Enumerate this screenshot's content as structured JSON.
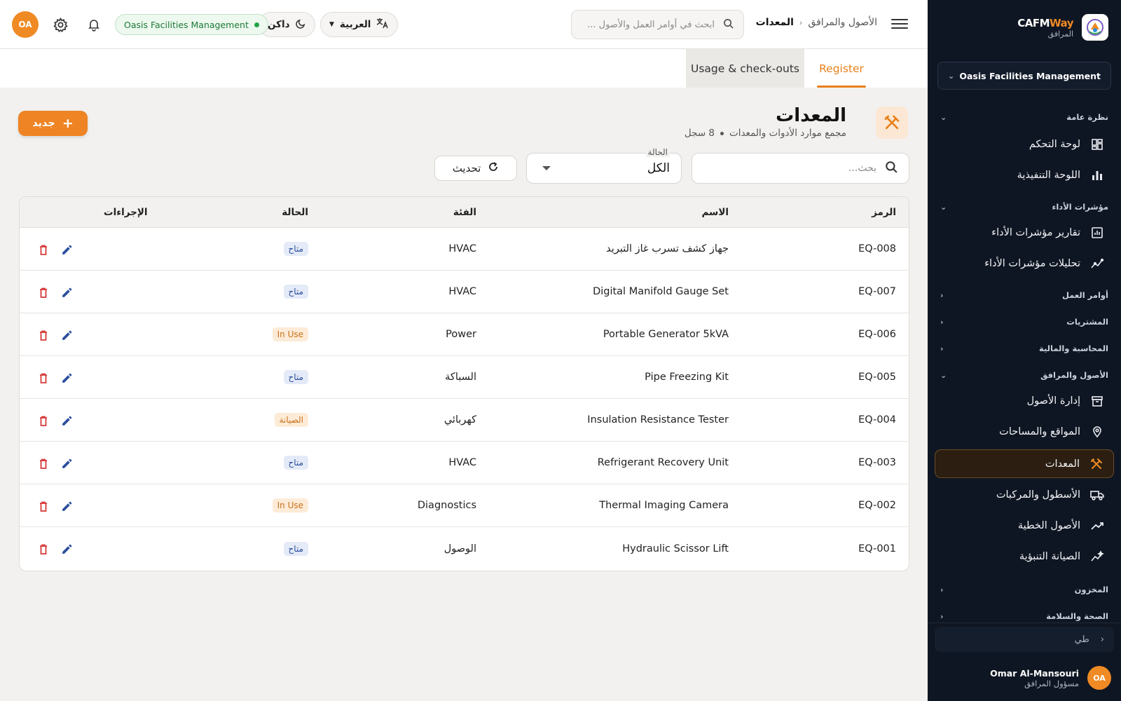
{
  "sidebar": {
    "brand": {
      "name_a": "CAFM",
      "name_b": "Way",
      "subtitle": "المرافق"
    },
    "org": "Oasis Facilities Management",
    "sections": [
      {
        "label": "نظرة عامة"
      },
      {
        "label": "مؤشرات الأداء"
      },
      {
        "label": "أوامر العمل"
      },
      {
        "label": "المشتريات"
      },
      {
        "label": "المحاسبة والمالية"
      },
      {
        "label": "الأصول والمرافق"
      },
      {
        "label": "المخزون"
      },
      {
        "label": "الصحة والسلامة"
      }
    ],
    "items": [
      {
        "label": "لوحة التحكم",
        "icon": "dashboard-icon"
      },
      {
        "label": "اللوحة التنفيذية",
        "icon": "bar-chart-icon"
      },
      {
        "label": "تقارير مؤشرات الأداء",
        "icon": "report-chart-icon"
      },
      {
        "label": "تحليلات مؤشرات الأداء",
        "icon": "analytics-icon"
      },
      {
        "label": "إدارة الأصول",
        "icon": "archive-icon"
      },
      {
        "label": "المواقع والمساحات",
        "icon": "location-pin-icon"
      },
      {
        "label": "المعدات",
        "icon": "tools-icon"
      },
      {
        "label": "الأسطول والمركبات",
        "icon": "truck-icon"
      },
      {
        "label": "الأصول الخطية",
        "icon": "trend-line-icon"
      },
      {
        "label": "الصيانة التنبؤية",
        "icon": "predictive-icon"
      }
    ],
    "collapse_label": "طي",
    "user": {
      "initials": "OA",
      "name": "Omar Al-Mansouri",
      "role": "مسؤول المرافق"
    }
  },
  "topbar": {
    "breadcrumb": {
      "parent": "الأصول والمرافق",
      "current": "المعدات"
    },
    "search_placeholder": "ابحث في أوامر العمل والأصول ...",
    "language": "العربية",
    "theme": "داكن",
    "org_badge": "Oasis Facilities Management",
    "avatar": "OA"
  },
  "tabs": {
    "register": "Register",
    "usage": "Usage & check-outs"
  },
  "page": {
    "title": "المعدات",
    "subtitle": "مجمع موارد الأدوات والمعدات",
    "count": "8 سجل",
    "new_button": "جديد"
  },
  "filters": {
    "search_placeholder": "بحث...",
    "status_label": "الحالة",
    "status_value": "الكل",
    "refresh": "تحديث"
  },
  "table": {
    "headers": {
      "code": "الرمز",
      "name": "الاسم",
      "category": "الفئة",
      "status": "الحالة",
      "actions": "الإجراءات"
    },
    "rows": [
      {
        "code": "EQ-008",
        "name": "جهاز كشف تسرب غاز التبريد",
        "category": "HVAC",
        "status": "متاح",
        "status_type": "available"
      },
      {
        "code": "EQ-007",
        "name": "Digital Manifold Gauge Set",
        "category": "HVAC",
        "status": "متاح",
        "status_type": "available"
      },
      {
        "code": "EQ-006",
        "name": "Portable Generator 5kVA",
        "category": "Power",
        "status": "In Use",
        "status_type": "inuse"
      },
      {
        "code": "EQ-005",
        "name": "Pipe Freezing Kit",
        "category": "السباكة",
        "status": "متاح",
        "status_type": "available"
      },
      {
        "code": "EQ-004",
        "name": "Insulation Resistance Tester",
        "category": "كهربائي",
        "status": "الصيانة",
        "status_type": "maint"
      },
      {
        "code": "EQ-003",
        "name": "Refrigerant Recovery Unit",
        "category": "HVAC",
        "status": "متاح",
        "status_type": "available"
      },
      {
        "code": "EQ-002",
        "name": "Thermal Imaging Camera",
        "category": "Diagnostics",
        "status": "In Use",
        "status_type": "inuse"
      },
      {
        "code": "EQ-001",
        "name": "Hydraulic Scissor Lift",
        "category": "الوصول",
        "status": "متاح",
        "status_type": "available"
      }
    ]
  },
  "colors": {
    "accent": "#ee8424",
    "sidebar_bg": "#0f1623",
    "delete": "#d63a3a",
    "edit": "#2b4f9d",
    "status_ok": "#22a447"
  }
}
